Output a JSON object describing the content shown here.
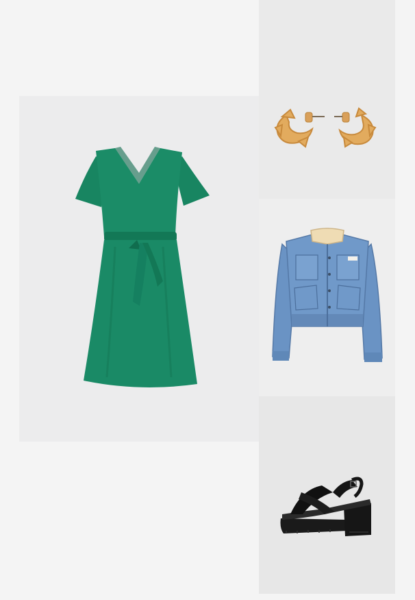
{
  "outfit": {
    "items": [
      {
        "id": "dress",
        "icon": "green-wrap-dress-image",
        "label": ""
      },
      {
        "id": "earrings",
        "icon": "gold-hoop-earrings-image",
        "label": ""
      },
      {
        "id": "jacket",
        "icon": "denim-jacket-image",
        "label": ""
      },
      {
        "id": "shoes",
        "icon": "black-platform-sandals-image",
        "label": ""
      }
    ]
  },
  "colors": {
    "background": "#f4f4f4",
    "dress": "#1a8a66",
    "earrings": "#e0a85a",
    "denim": "#6d95c5",
    "collar": "#efdcb4",
    "sandals": "#1c1c1c"
  }
}
